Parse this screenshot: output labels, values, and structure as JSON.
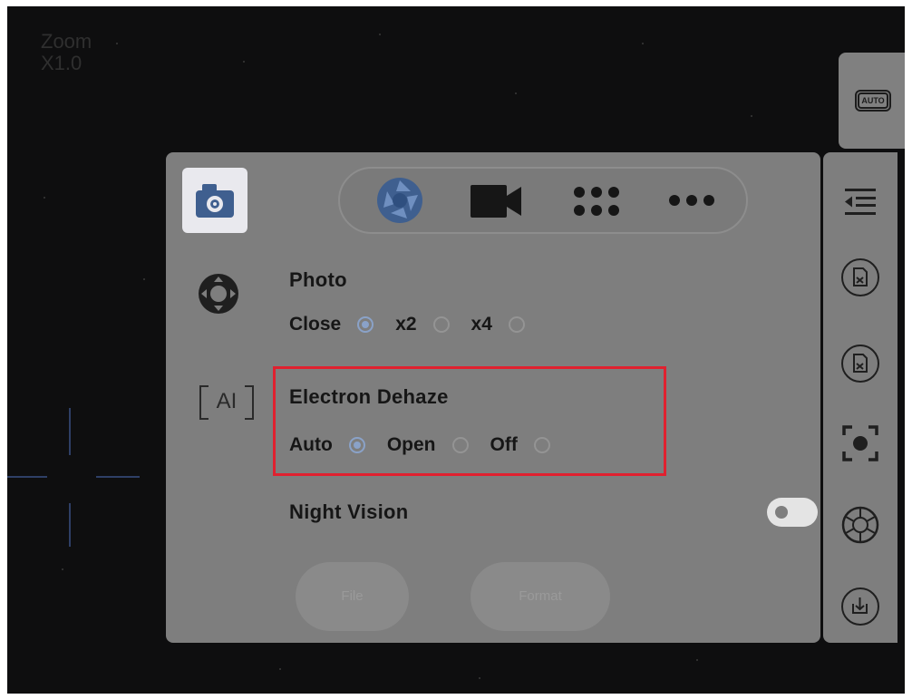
{
  "zoom": {
    "label": "Zoom",
    "value": "X1.0"
  },
  "top_right": {
    "auto_badge": "AUTO"
  },
  "sidebar": {
    "camera_icon": "camera-icon",
    "joystick_icon": "joystick-icon",
    "ai_label": "AI"
  },
  "tabs": [
    {
      "icon": "aperture-icon",
      "active": true
    },
    {
      "icon": "video-camera-icon",
      "active": false
    },
    {
      "icon": "grid-icon",
      "active": false
    },
    {
      "icon": "more-icon",
      "active": false
    }
  ],
  "photo": {
    "title": "Photo",
    "options": [
      "Close",
      "x2",
      "x4"
    ],
    "selected": "Close"
  },
  "dehaze": {
    "title": "Electron Dehaze",
    "options": [
      "Auto",
      "Open",
      "Off"
    ],
    "selected": "Auto"
  },
  "night_vision": {
    "title": "Night Vision",
    "enabled": false
  },
  "buttons": {
    "file": "File",
    "format": "Format"
  },
  "rail_icons": [
    "collapse-menu-icon",
    "sd-card-icon",
    "sd-card-icon",
    "focus-record-icon",
    "shutter-icon",
    "download-icon"
  ],
  "colors": {
    "accent": "#3f5f8f",
    "highlight": "#e0212f",
    "panel": "#7e7e7e"
  }
}
